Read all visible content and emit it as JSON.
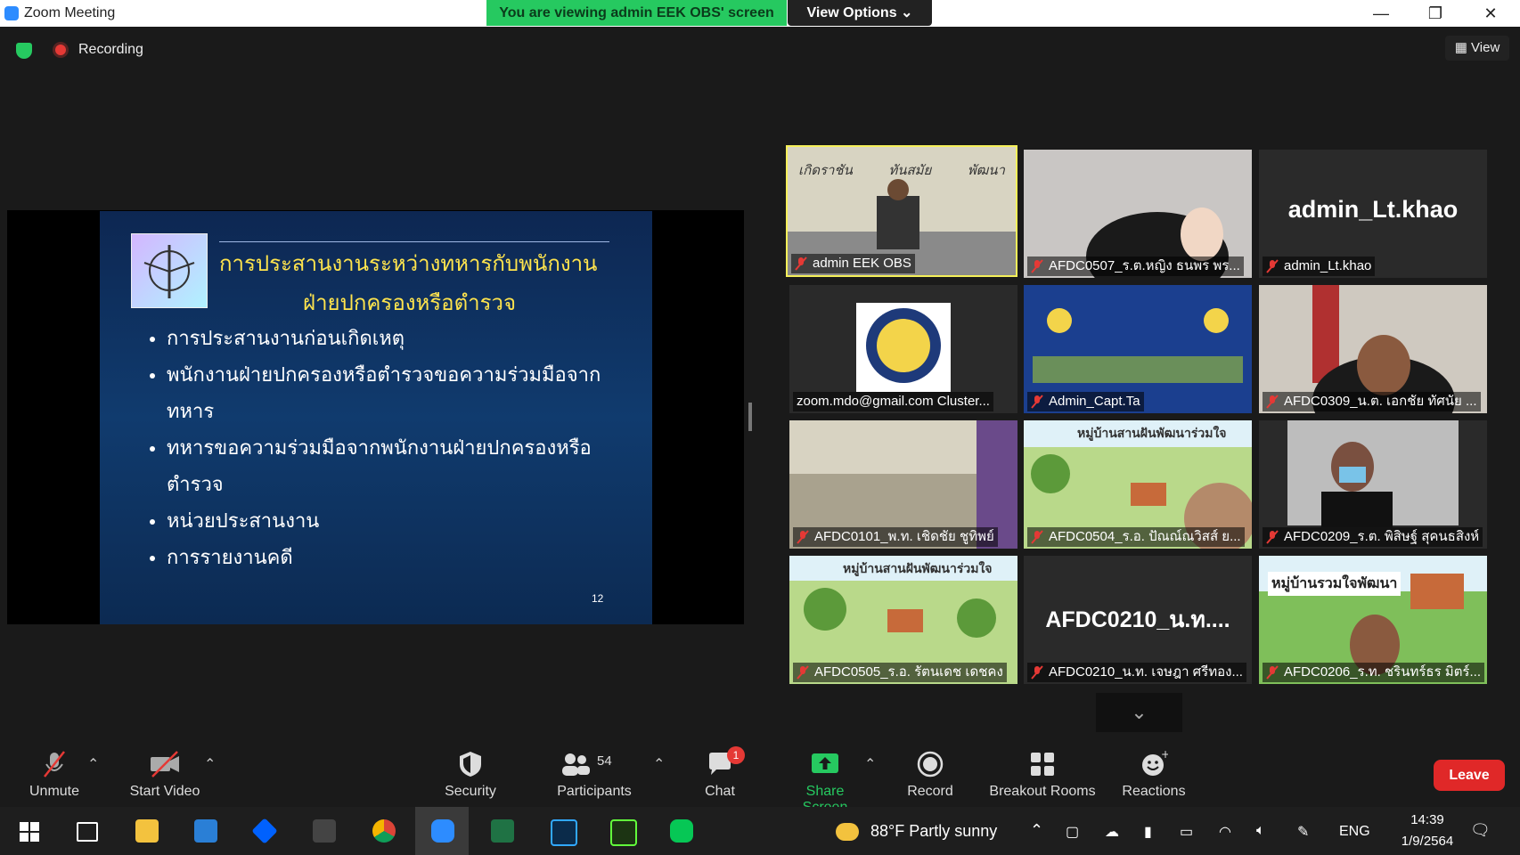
{
  "window": {
    "title": "Zoom Meeting"
  },
  "share_banner": {
    "text": "You are viewing admin EEK OBS' screen",
    "view_options": "View Options ⌄"
  },
  "status": {
    "recording": "Recording",
    "view": "View"
  },
  "slide": {
    "title_line1": "การประสานงานระหว่างทหารกับพนักงาน",
    "title_line2": "ฝ่ายปกครองหรือตำรวจ",
    "bullets": [
      "การประสานงานก่อนเกิดเหตุ",
      "พนักงานฝ่ายปกครองหรือตำรวจขอความร่วมมือจากทหาร",
      "ทหารขอความร่วมมือจากพนักงานฝ่ายปกครองหรือตำรวจ",
      "หน่วยประสานงาน",
      "การรายงานคดี"
    ],
    "page_number": "12"
  },
  "gallery": {
    "tiles": [
      {
        "name": "admin EEK OBS",
        "header": [
          "เกิดราชัน",
          "ทันสมัย",
          "พัฒนา"
        ],
        "active": true
      },
      {
        "name": "AFDC0507_ร.ต.หญิง ธนพร พร..."
      },
      {
        "name": "admin_Lt.khao",
        "big_name": "admin_Lt.khao"
      },
      {
        "name": "zoom.mdo@gmail.com Cluster..."
      },
      {
        "name": "Admin_Capt.Ta"
      },
      {
        "name": "AFDC0309_น.ต. เอกชัย ทัศนัย ..."
      },
      {
        "name": "AFDC0101_พ.ท. เชิดชัย ชูทิพย์"
      },
      {
        "name": "AFDC0504_ร.อ. ปัณณ์ณวิสส์ ย...",
        "banner": "หมู่บ้านสานฝันพัฒนาร่วมใจ"
      },
      {
        "name": "AFDC0209_ร.ต. พิสิษฐ์ สุคนธสิงห์"
      },
      {
        "name": "AFDC0505_ร.อ. รัตนเดช เดชคง",
        "banner": "หมู่บ้านสานฝันพัฒนาร่วมใจ"
      },
      {
        "name": "AFDC0210_น.ท. เจษฎา ศรีทอง...",
        "big_name": "AFDC0210_น.ท...."
      },
      {
        "name": "AFDC0206_ร.ท. ชรินทร์ธร มิตร์...",
        "banner": "หมู่บ้านรวมใจพัฒนา"
      }
    ]
  },
  "toolbar": {
    "unmute": "Unmute",
    "start_video": "Start Video",
    "security": "Security",
    "participants": "Participants",
    "participants_count": "54",
    "chat": "Chat",
    "chat_badge": "1",
    "share_screen": "Share Screen",
    "record": "Record",
    "breakout_rooms": "Breakout Rooms",
    "reactions": "Reactions",
    "leave": "Leave"
  },
  "taskbar": {
    "weather": "88°F  Partly sunny",
    "language": "ENG",
    "time": "14:39",
    "date": "1/9/2564"
  },
  "colors": {
    "accent_green": "#26c960",
    "leave_red": "#e02828",
    "active_tile": "#f5f05a"
  }
}
